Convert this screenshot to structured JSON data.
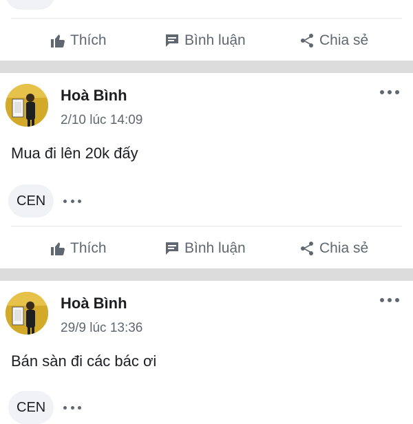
{
  "actions": {
    "like": "Thích",
    "comment": "Bình luận",
    "share": "Chia sẻ"
  },
  "posts": [
    {
      "author": "Hoà Bình",
      "time": "2/10 lúc 14:09",
      "text": "Mua đi lên 20k đấy",
      "chip": "CEN"
    },
    {
      "author": "Hoà Bình",
      "time": "29/9 lúc 13:36",
      "text": "Bán sàn đi các bác ơi",
      "chip": "CEN"
    }
  ],
  "icons": {
    "like": "thumbs-up-icon",
    "comment": "comment-icon",
    "share": "share-icon",
    "more": "more-dots-icon"
  },
  "colors": {
    "separator": "#dcdcdc",
    "secondary_text": "#606770",
    "chip_bg": "#f0f2f5"
  }
}
